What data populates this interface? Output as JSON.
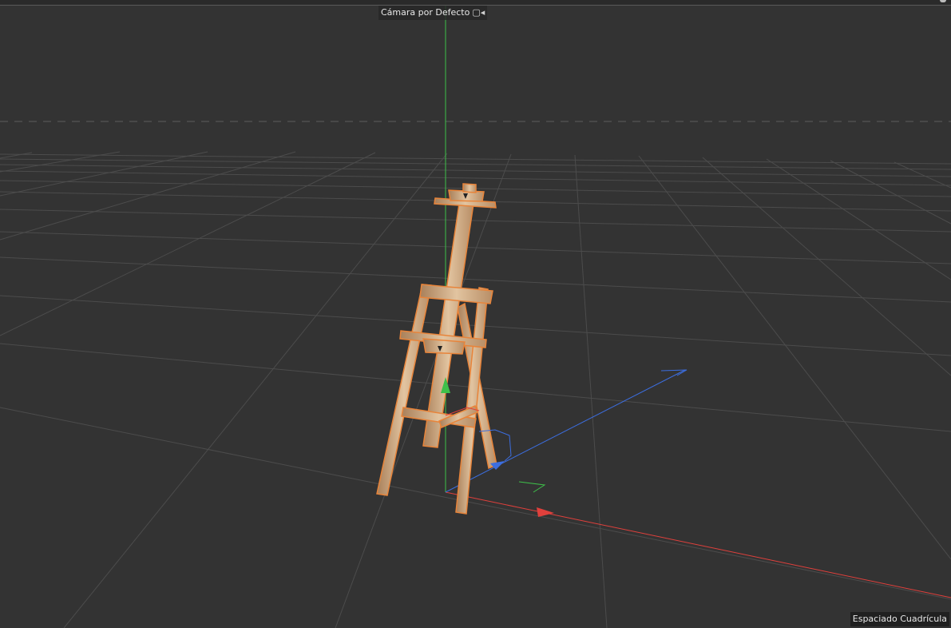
{
  "viewport": {
    "camera_label": "Cámara por Defecto",
    "camera_icon": "camera-icon",
    "grid_spacing_label": "Espaciado Cuadrícula"
  },
  "colors": {
    "background": "#333333",
    "grid_line": "#4a4a4a",
    "grid_major": "#5a5a5a",
    "axis_x": "#e0403c",
    "axis_y": "#3ec04a",
    "axis_z": "#3c6ee0",
    "wood": "#c8a07a",
    "selection_outline": "#e8843a"
  }
}
